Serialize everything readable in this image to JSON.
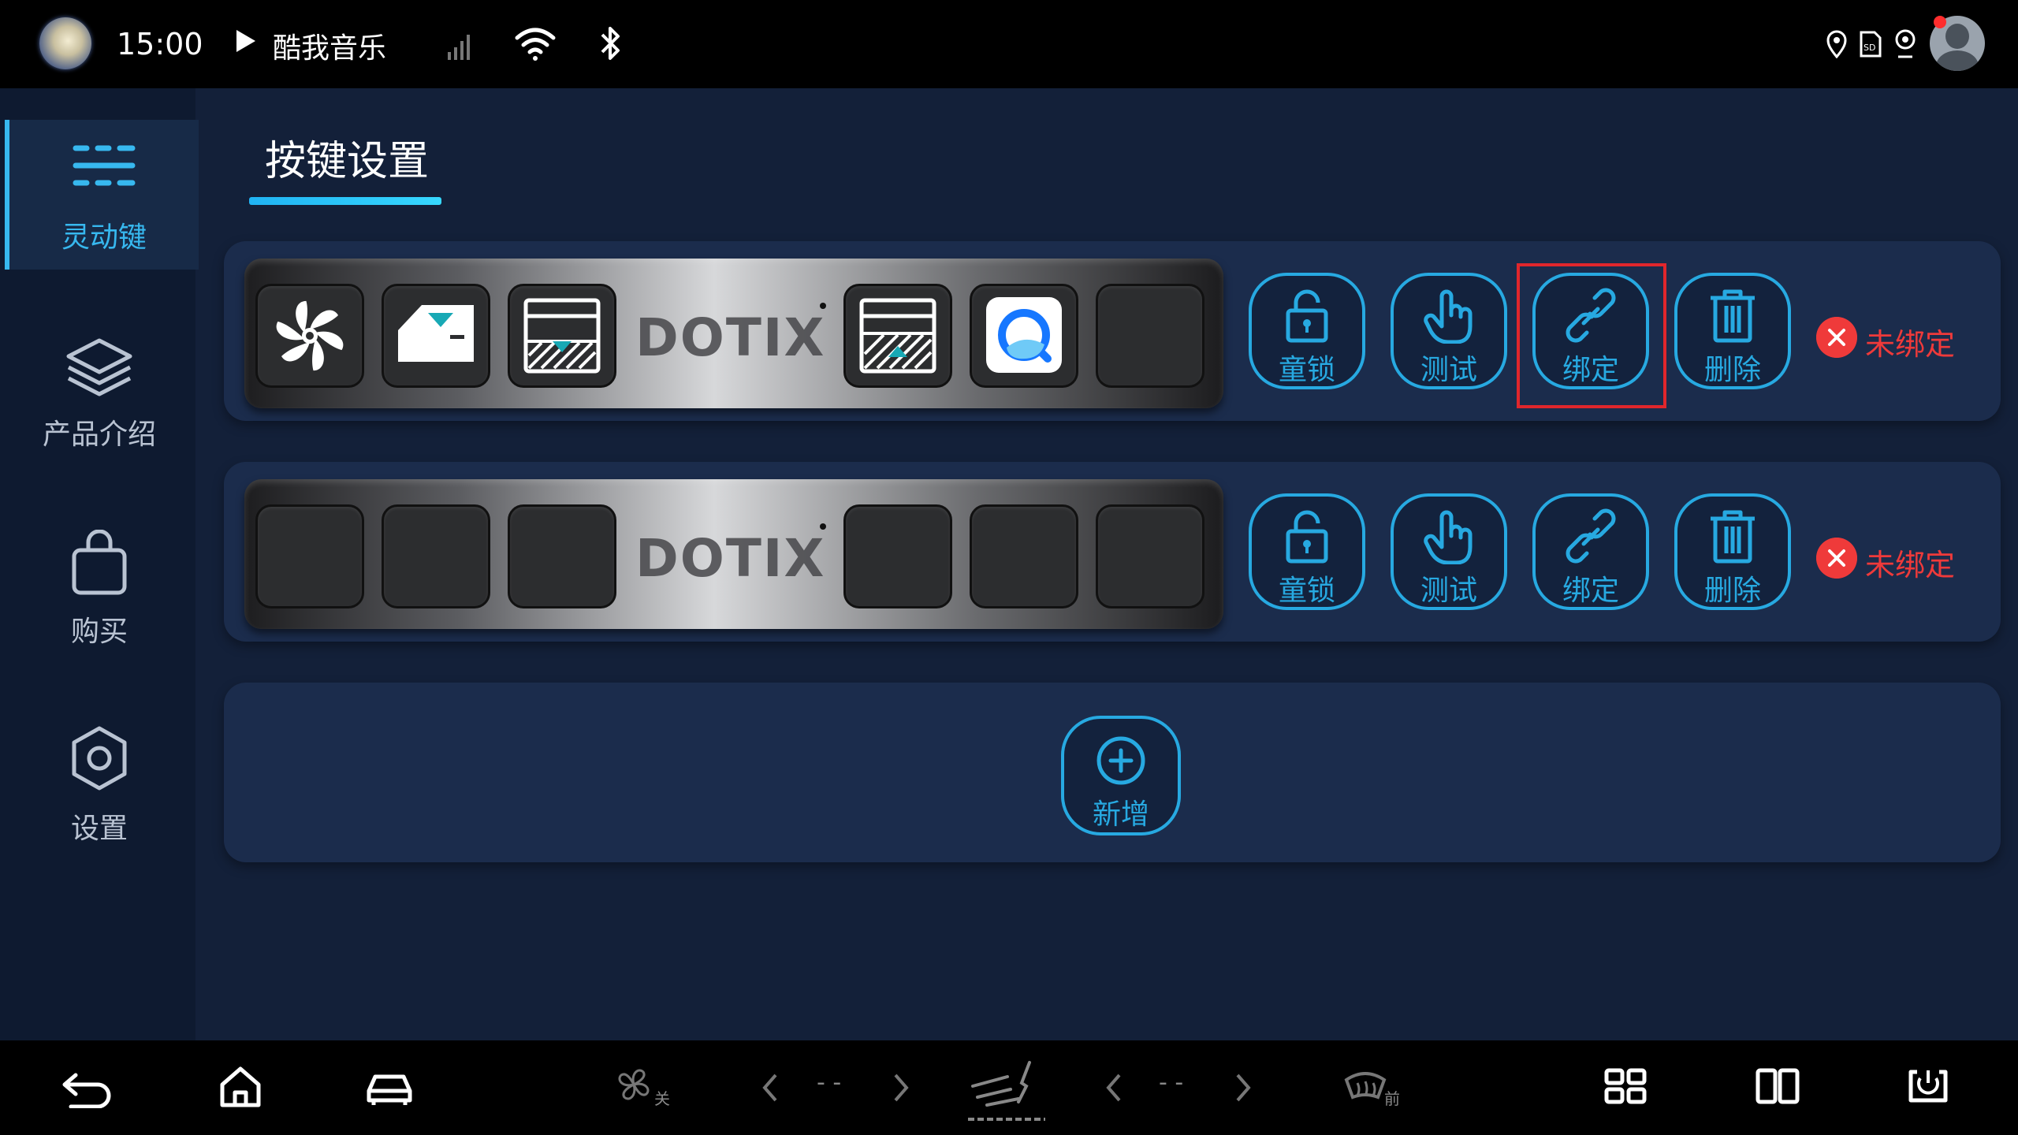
{
  "status_bar": {
    "time": "15:00",
    "music_app": "酷我音乐",
    "icons": [
      "signal-icon",
      "wifi-icon",
      "bluetooth-icon",
      "location-icon",
      "sd-card-icon",
      "camera-icon",
      "user-avatar"
    ]
  },
  "sidebar": {
    "items": [
      {
        "label": "灵动键",
        "icon": "menu-lines-icon",
        "active": true
      },
      {
        "label": "产品介绍",
        "icon": "layers-icon",
        "active": false
      },
      {
        "label": "购买",
        "icon": "shopping-bag-icon",
        "active": false
      },
      {
        "label": "设置",
        "icon": "gear-icon",
        "active": false
      }
    ]
  },
  "page": {
    "title": "按键设置"
  },
  "devices": [
    {
      "brand": "DOTIX",
      "keys": [
        "fan-icon",
        "car-door-icon",
        "window-down-icon",
        "window-up-icon",
        "browser-app-icon",
        "empty-key"
      ],
      "actions": {
        "lock": "童锁",
        "test": "测试",
        "bind": "绑定",
        "delete": "删除"
      },
      "status": "未绑定"
    },
    {
      "brand": "DOTIX",
      "keys": [
        "empty-key",
        "empty-key",
        "empty-key",
        "empty-key",
        "empty-key",
        "empty-key"
      ],
      "actions": {
        "lock": "童锁",
        "test": "测试",
        "bind": "绑定",
        "delete": "删除"
      },
      "status": "未绑定"
    }
  ],
  "add_button": {
    "label": "新增"
  },
  "nav_bar": {
    "fan_status": "关",
    "left_value": "- -",
    "right_value": "- -",
    "defrost_label": "前"
  },
  "colors": {
    "accent": "#27a9e1",
    "warning": "#ef3a3a",
    "background": "#132039",
    "panel": "#1b2c4c"
  }
}
